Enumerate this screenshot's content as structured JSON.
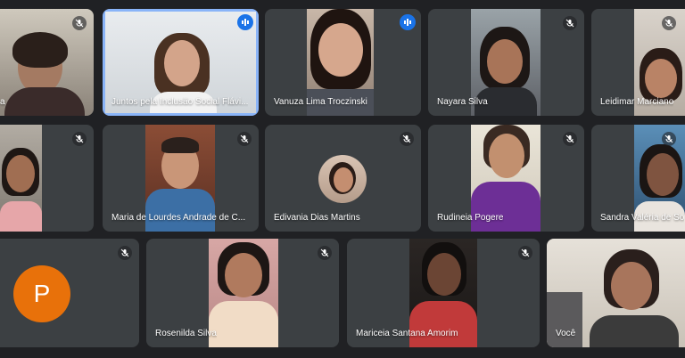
{
  "participants": [
    {
      "name": "a",
      "muted": true
    },
    {
      "name": "Juntos pela Inclusão Social Flávi...",
      "speaking": true
    },
    {
      "name": "Vanuza Lima Troczinski",
      "speaking": true
    },
    {
      "name": "Nayara Silva",
      "muted": true
    },
    {
      "name": "Leidimar Marciano",
      "muted": true
    },
    {
      "name": "",
      "muted": true
    },
    {
      "name": "Maria de Lourdes Andrade de C...",
      "muted": true
    },
    {
      "name": "Edivania Dias Martins",
      "muted": true
    },
    {
      "name": "Rudineia Pogere",
      "muted": true
    },
    {
      "name": "Sandra Valéria de So",
      "muted": true
    },
    {
      "name": "",
      "avatar_letter": "P",
      "avatar_color": "#e8710a",
      "muted": true
    },
    {
      "name": "Rosenilda Silva",
      "muted": true
    },
    {
      "name": "Mariceia Santana Amorim",
      "muted": true
    },
    {
      "name": "Você"
    }
  ],
  "icons": {
    "mute": "mic-off-icon",
    "speaking": "audio-level-icon"
  },
  "colors": {
    "background": "#202124",
    "tile": "#3c4043",
    "accent": "#1a73e8"
  }
}
